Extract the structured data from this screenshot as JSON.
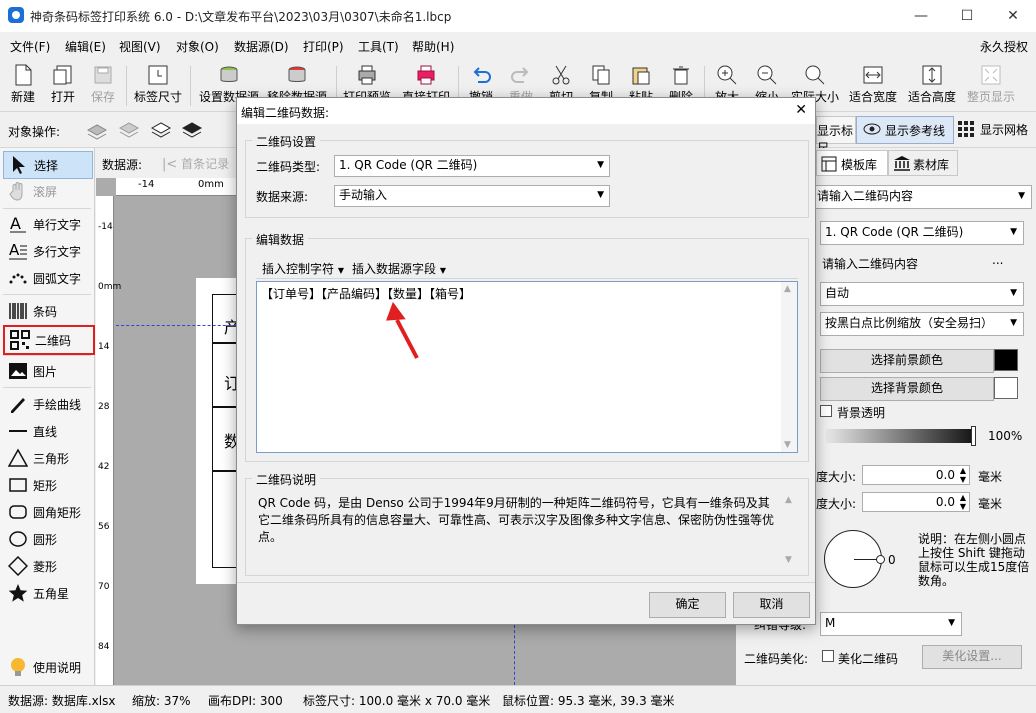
{
  "window": {
    "title": "神奇条码标签打印系统 6.0 - D:\\文章发布平台\\2023\\03月\\0307\\未命名1.lbcp",
    "minimize": "—",
    "maximize": "☐",
    "close": "✕"
  },
  "menu": [
    "文件(F)",
    "编辑(E)",
    "视图(V)",
    "对象(O)",
    "数据源(D)",
    "打印(P)",
    "工具(T)",
    "帮助(H)"
  ],
  "menu_right": "永久授权",
  "toolbar": {
    "new": "新建",
    "open": "打开",
    "save": "保存",
    "label_size": "标签尺寸",
    "set_datasource": "设置数据源",
    "move_datasource": "移除数据源",
    "print_preview": "打印预览",
    "direct_print": "直接打印",
    "undo": "撤销",
    "redo": "重做",
    "cut": "剪切",
    "copy": "复制",
    "paste": "粘贴",
    "delete": "删除",
    "zoom_in": "放大",
    "zoom_out": "缩小",
    "actual_size": "实际大小",
    "fit_width": "适合宽度",
    "fit_height": "适合高度",
    "whole_page": "整页显示"
  },
  "opsbar": {
    "label": "对象操作:",
    "show_ruler": "显示标尺",
    "show_guides": "显示参考线",
    "show_grid": "显示网格"
  },
  "tools": {
    "select": "选择",
    "scroll": "滚屏",
    "single_text": "单行文字",
    "multi_text": "多行文字",
    "arc_text": "圆弧文字",
    "barcode": "条码",
    "qrcode": "二维码",
    "image": "图片",
    "freehand": "手绘曲线",
    "line": "直线",
    "triangle": "三角形",
    "rect": "矩形",
    "round_rect": "圆角矩形",
    "circle": "圆形",
    "diamond": "菱形",
    "star": "五角星",
    "help": "使用说明"
  },
  "datasource_bar": {
    "label": "数据源:",
    "first_record": "首条记录"
  },
  "ruler": {
    "h_ticks": [
      "-14",
      "0mm"
    ],
    "v_ticks": [
      "-14",
      "0mm",
      "14",
      "28",
      "42",
      "56",
      "70",
      "84"
    ]
  },
  "label_preview_chars": [
    "产",
    "订",
    "数"
  ],
  "right_panel": {
    "tab_templates": "模板库",
    "tab_materials": "素材库",
    "content_placeholder": "请输入二维码内容",
    "code_type": "1. QR Code (QR 二维码)",
    "content_field": "请输入二维码内容",
    "ellipsis": "...",
    "encoding": "自动",
    "scaling": "按黑白点比例缩放（安全易扫）",
    "fg_color_btn": "选择前景颜色",
    "bg_color_btn": "选择背景颜色",
    "bg_transparent": "背景透明",
    "opacity": "100%",
    "size_label_1": "度大小:",
    "size_value_1": "0.0",
    "size_unit_1": "毫米",
    "size_label_2": "度大小:",
    "size_value_2": "0.0",
    "size_unit_2": "毫米",
    "rotation_value": "0",
    "rotation_note": "说明：在左侧小圆点上按住 Shift 键拖动鼠标可以生成15度倍数角。",
    "ecc_label": "纠错等级:",
    "ecc_value": "M",
    "beautify_label": "二维码美化:",
    "beautify_check": "美化二维码",
    "beautify_btn": "美化设置...",
    "fg_color": "#000000",
    "bg_color": "#ffffff"
  },
  "dialog": {
    "title": "编辑二维码数据:",
    "close": "✕",
    "group_settings": "二维码设置",
    "type_label": "二维码类型:",
    "type_value": "1. QR Code (QR 二维码)",
    "source_label": "数据来源:",
    "source_value": "手动输入",
    "group_edit": "编辑数据",
    "insert_control": "插入控制字符",
    "insert_field": "插入数据源字段",
    "data_text": "【订单号】【产品编码】【数量】【箱号】",
    "group_desc": "二维码说明",
    "desc_text": "QR Code 码，是由 Denso 公司于1994年9月研制的一种矩阵二维码符号，它具有一维条码及其它二维条码所具有的信息容量大、可靠性高、可表示汉字及图像多种文字信息、保密防伪性强等优点。",
    "ok": "确定",
    "cancel": "取消"
  },
  "status": {
    "datasource": "数据源: 数据库.xlsx",
    "zoom": "缩放: 37%",
    "dpi": "画布DPI: 300",
    "label_size": "标签尺寸: 100.0 毫米 x 70.0 毫米",
    "mouse_pos": "鼠标位置: 95.3 毫米, 39.3 毫米"
  },
  "colors": {
    "accent": "#1b6fd6",
    "highlight_border": "#e02020",
    "arrow": "#e02020"
  }
}
